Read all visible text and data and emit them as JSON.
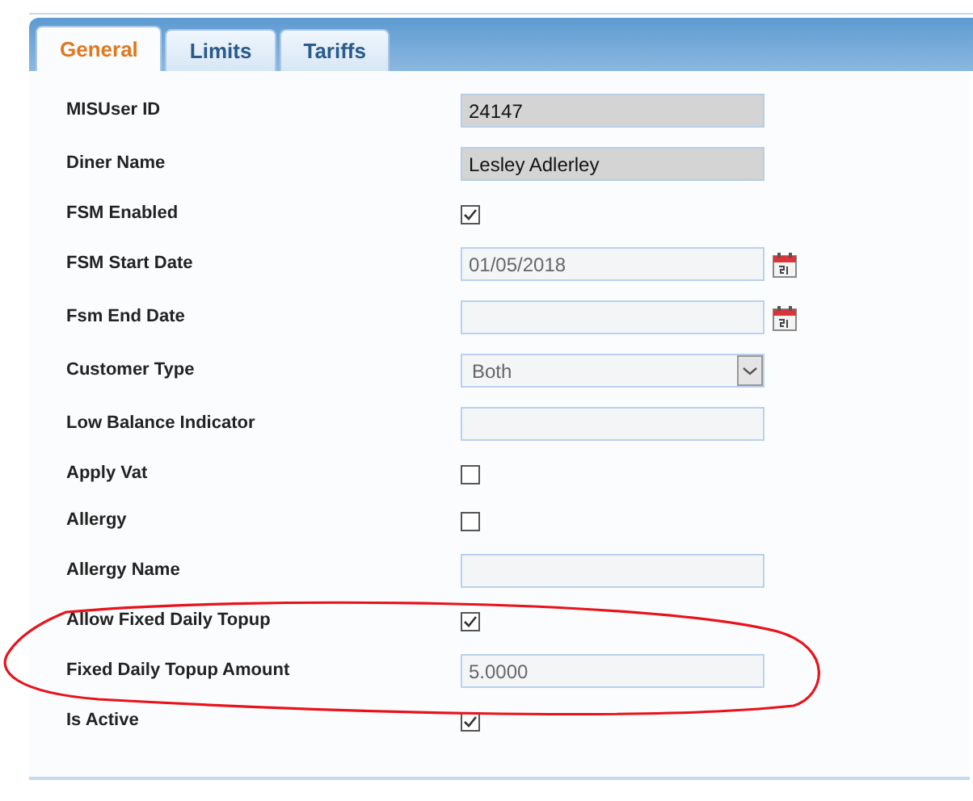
{
  "tabs": [
    {
      "label": "General",
      "selected": true
    },
    {
      "label": "Limits",
      "selected": false
    },
    {
      "label": "Tariffs",
      "selected": false
    }
  ],
  "fields": [
    {
      "label": "MISUser ID",
      "kind": "locked",
      "value": "24147"
    },
    {
      "label": "Diner Name",
      "kind": "locked",
      "value": "Lesley Adlerley"
    },
    {
      "label": "FSM Enabled",
      "kind": "checkbox",
      "checked": true
    },
    {
      "label": "FSM Start Date",
      "kind": "date",
      "value": "01/05/2018"
    },
    {
      "label": "Fsm End Date",
      "kind": "date"
    },
    {
      "label": "Customer Type",
      "kind": "select",
      "value": "Both"
    },
    {
      "label": "Low Balance Indicator",
      "kind": "text"
    },
    {
      "label": "Apply Vat",
      "kind": "checkbox",
      "checked": false
    },
    {
      "label": "Allergy",
      "kind": "checkbox",
      "checked": false
    },
    {
      "label": "Allergy Name",
      "kind": "text"
    },
    {
      "label": "Allow Fixed Daily Topup",
      "kind": "checkbox",
      "checked": true
    },
    {
      "label": "Fixed Daily Topup Amount",
      "kind": "text",
      "value": "5.0000"
    },
    {
      "label": "Is Active",
      "kind": "checkbox",
      "checked": true
    }
  ]
}
